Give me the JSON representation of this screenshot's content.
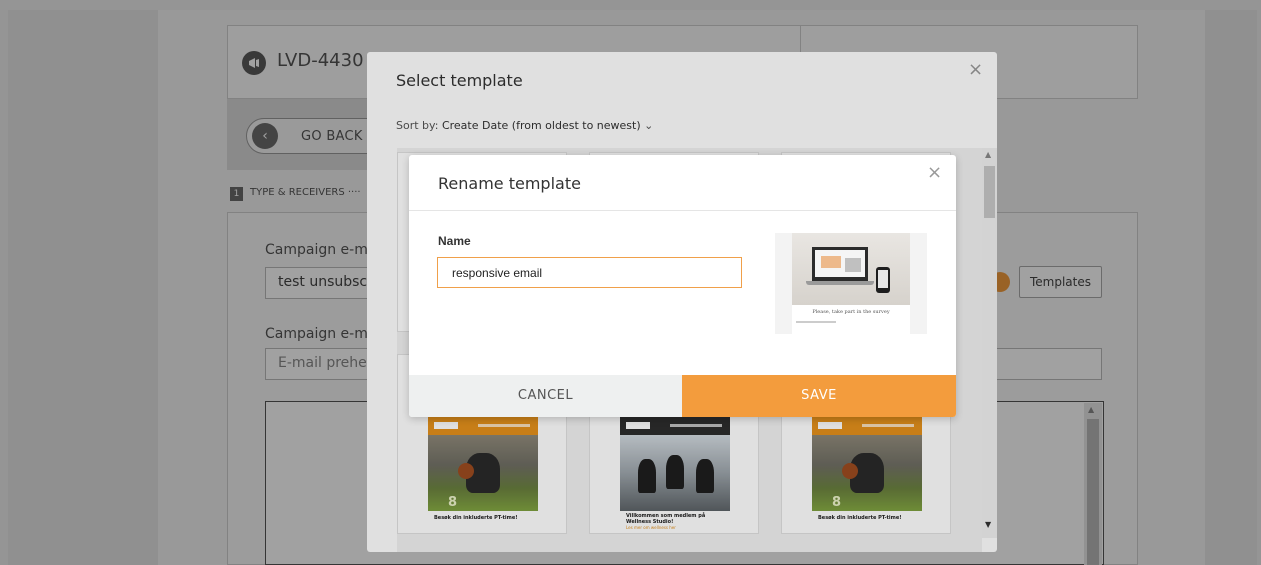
{
  "background": {
    "campaign_id": "LVD-4430",
    "go_back_label": "GO BACK",
    "step_number": "1",
    "step_label": "TYPE & RECEIVERS ····",
    "subject_label": "Campaign e-ma",
    "subject_value": "test unsubscr",
    "preheader_label": "Campaign e-ma",
    "preheader_placeholder": "E-mail prehea",
    "templates_button": "Templates"
  },
  "select_modal": {
    "title": "Select template",
    "close": "×",
    "sort_label": "Sort by:",
    "sort_value": "Create Date (from oldest to newest)",
    "sort_chevron": "chevron-down-icon",
    "cards": [
      {
        "style": "gym",
        "caption": "Besøk din inkluderte PT-time!"
      },
      {
        "style": "team",
        "caption": "Villkommen som medlem på Wellness Studio!",
        "link": "Les mer om wellness her"
      },
      {
        "style": "gym",
        "caption": "Besøk din inkluderte PT-time!"
      }
    ]
  },
  "rename_modal": {
    "title": "Rename template",
    "close": "×",
    "name_label": "Name",
    "name_value": "responsive email",
    "preview_caption": "Please, take part in the survey",
    "cancel_label": "CANCEL",
    "save_label": "SAVE"
  },
  "colors": {
    "accent": "#f39c3d",
    "input_border": "#f0a04a"
  }
}
